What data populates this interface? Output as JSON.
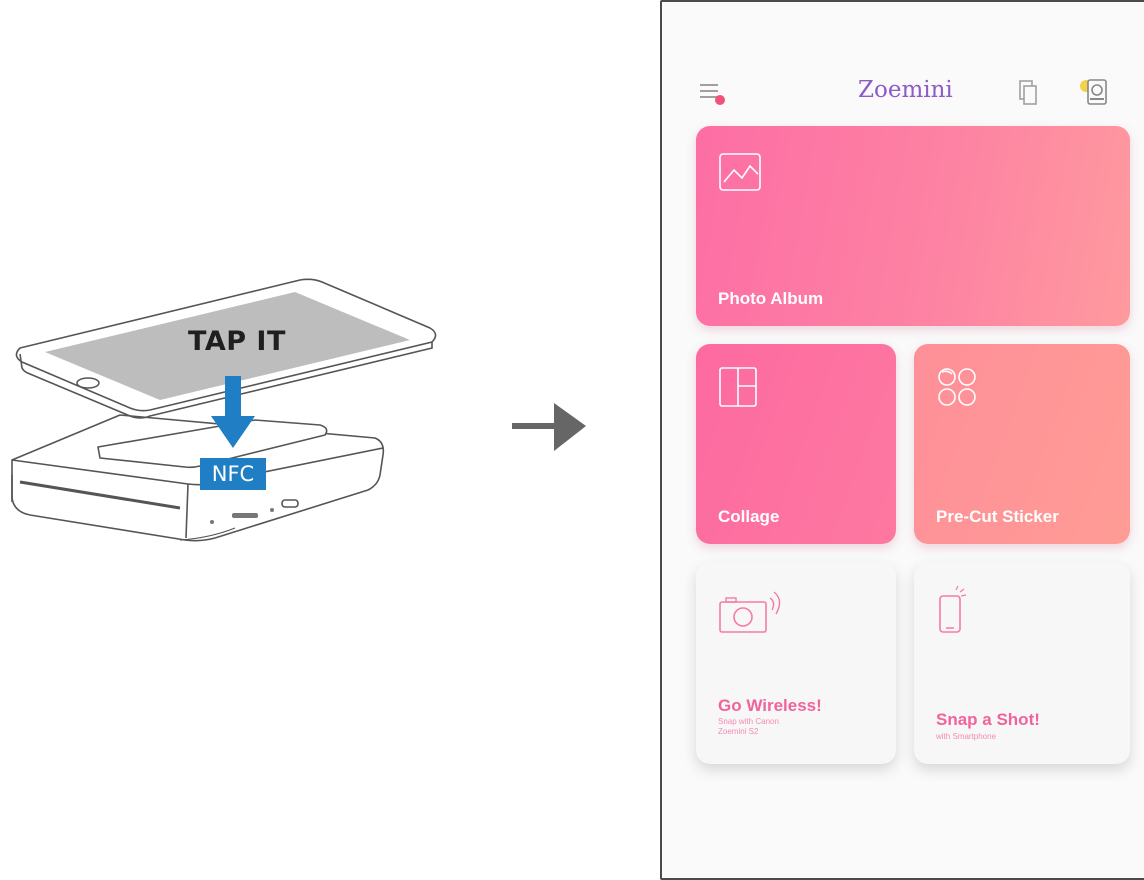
{
  "illustration": {
    "tap_label": "TAP IT",
    "nfc_label": "NFC"
  },
  "app": {
    "title": "Zoemini",
    "icons": {
      "menu": "menu-notification-icon",
      "copies": "copies-icon",
      "printer": "printer-status-icon"
    },
    "cards": {
      "photo_album": {
        "label": "Photo Album",
        "icon": "image-icon"
      },
      "collage": {
        "label": "Collage",
        "icon": "collage-layout-icon"
      },
      "pre_cut_sticker": {
        "label": "Pre-Cut Sticker",
        "icon": "sticker-circles-icon"
      },
      "go_wireless": {
        "label": "Go Wireless!",
        "sub_line1": "Snap with Canon",
        "sub_line2": "Zoemini S2",
        "icon": "wireless-camera-icon"
      },
      "snap_a_shot": {
        "label": "Snap a Shot!",
        "sub": "with Smartphone",
        "icon": "smartphone-icon"
      }
    },
    "colors": {
      "title": "#8c5cc7",
      "accent_pink": "#fd6ea4",
      "notification_dot": "#f0527e",
      "printer_dot": "#f2d24b",
      "nfc_blue": "#1f7ec4"
    }
  }
}
